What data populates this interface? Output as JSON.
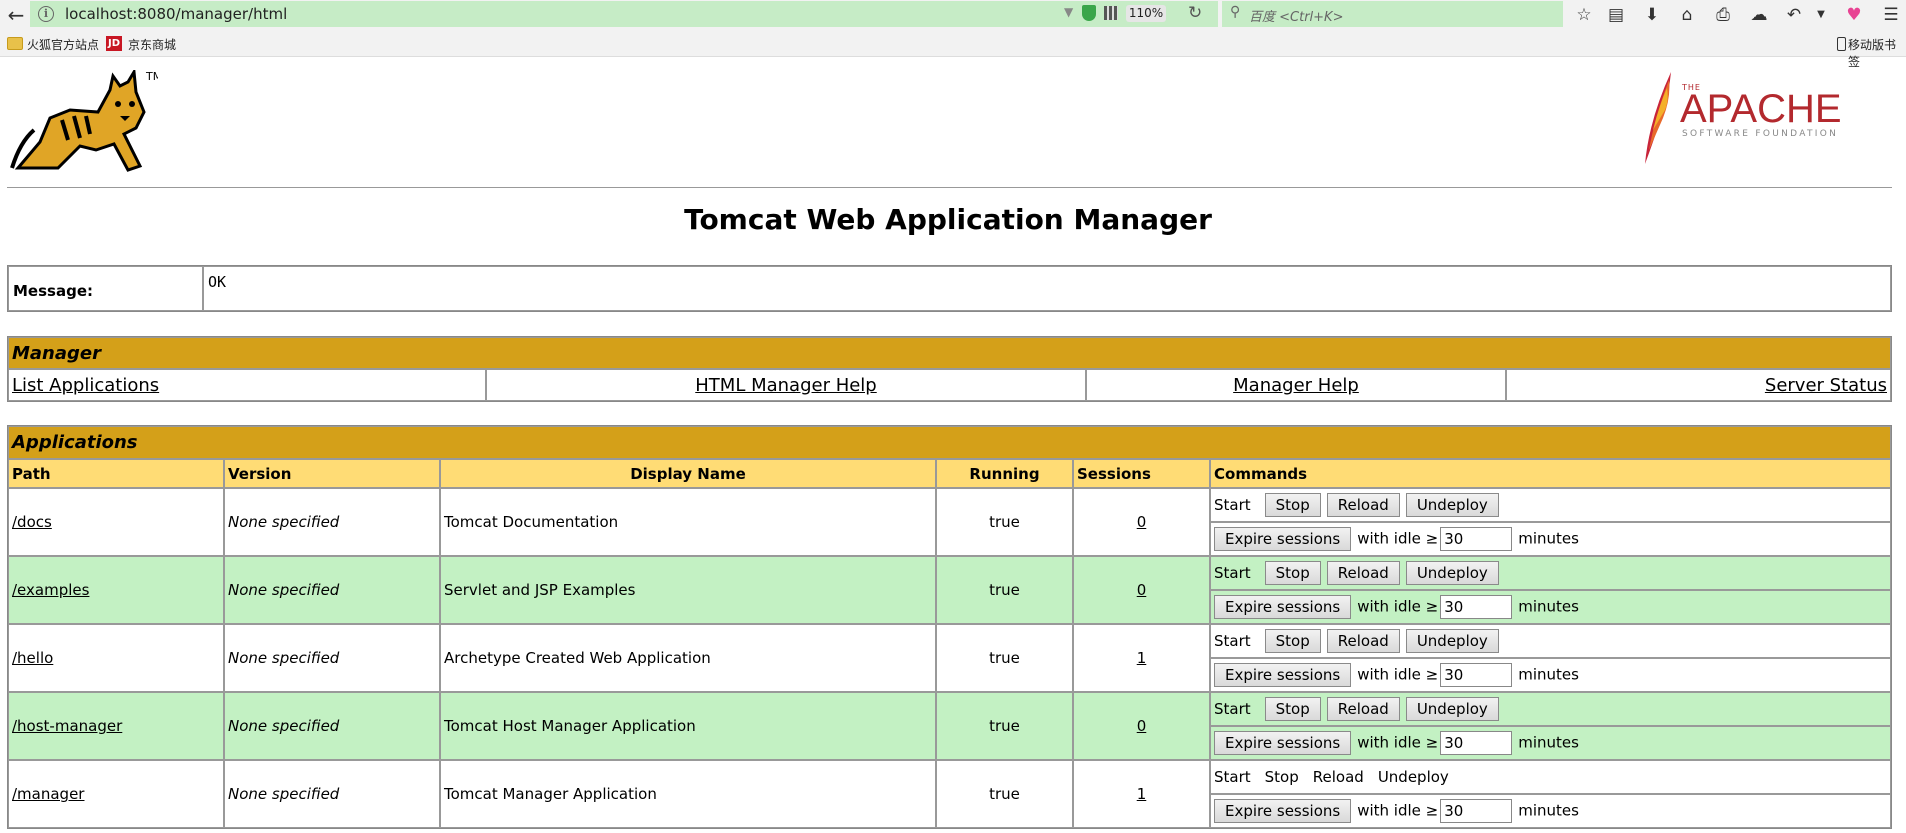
{
  "browser": {
    "url": "localhost:8080/manager/html",
    "zoom": "110%",
    "search_placeholder": "百度 <Ctrl+K>",
    "bookmarks": [
      "火狐官方站点",
      "京东商城"
    ],
    "mobile_bookmarks": "移动版书签",
    "jd_icon_text": "JD"
  },
  "page": {
    "title": "Tomcat Web Application Manager",
    "tomcat_tm": "TM",
    "apache_the": "THE",
    "apache_name": "APACHE",
    "apache_sub": "SOFTWARE FOUNDATION"
  },
  "message": {
    "label": "Message:",
    "value": "OK"
  },
  "manager": {
    "heading": "Manager",
    "links": [
      "List Applications",
      "HTML Manager Help",
      "Manager Help",
      "Server Status"
    ]
  },
  "applications": {
    "heading": "Applications",
    "columns": [
      "Path",
      "Version",
      "Display Name",
      "Running",
      "Sessions",
      "Commands"
    ],
    "rows": [
      {
        "path": "/docs",
        "version": "None specified",
        "display_name": "Tomcat Documentation",
        "running": "true",
        "sessions": "0"
      },
      {
        "path": "/examples",
        "version": "None specified",
        "display_name": "Servlet and JSP Examples",
        "running": "true",
        "sessions": "0"
      },
      {
        "path": "/hello",
        "version": "None specified",
        "display_name": "Archetype Created Web Application",
        "running": "true",
        "sessions": "1"
      },
      {
        "path": "/host-manager",
        "version": "None specified",
        "display_name": "Tomcat Host Manager Application",
        "running": "true",
        "sessions": "0"
      },
      {
        "path": "/manager",
        "version": "None specified",
        "display_name": "Tomcat Manager Application",
        "running": "true",
        "sessions": "1"
      }
    ],
    "commands": {
      "start": "Start",
      "stop": "Stop",
      "reload": "Reload",
      "undeploy": "Undeploy",
      "expire": "Expire sessions",
      "with_idle": "with idle ≥",
      "idle_value": "30",
      "minutes": "minutes"
    }
  },
  "colors": {
    "section_bg": "#d4a019",
    "header_bg": "#ffdc75",
    "row_alt_bg": "#c3f1c3",
    "urlbar_bg": "#c6ecc6"
  }
}
